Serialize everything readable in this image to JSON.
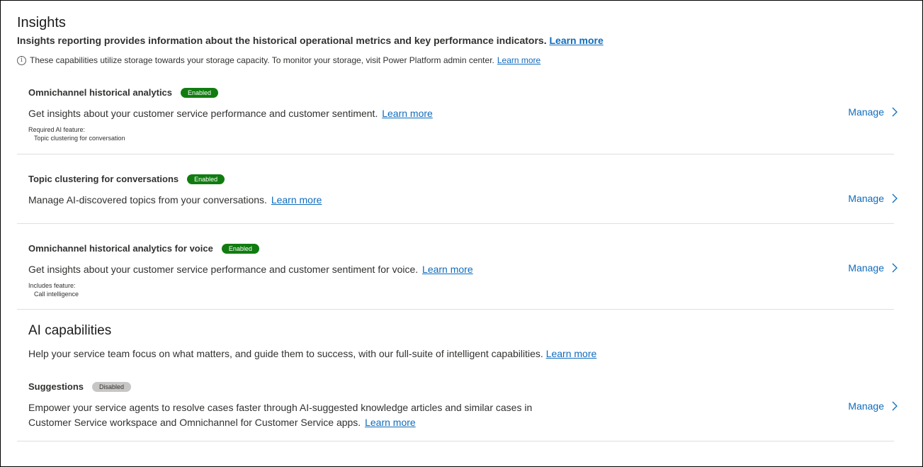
{
  "insights": {
    "title": "Insights",
    "description": "Insights reporting provides information about the historical operational metrics and key performance indicators.",
    "learn_more": "Learn more",
    "notice": "These capabilities utilize storage towards your storage capacity. To monitor your storage, visit Power Platform admin center.",
    "notice_learn_more": "Learn more"
  },
  "cards": [
    {
      "title": "Omnichannel historical analytics",
      "badge": "Enabled",
      "description": "Get insights about your customer service performance and customer sentiment.",
      "learn_more": "Learn more",
      "meta_label": "Required AI feature:",
      "meta_value": "Topic clustering for conversation",
      "manage": "Manage"
    },
    {
      "title": "Topic clustering for conversations",
      "badge": "Enabled",
      "description": "Manage AI-discovered topics from your conversations.",
      "learn_more": "Learn more",
      "manage": "Manage"
    },
    {
      "title": "Omnichannel historical analytics for voice",
      "badge": "Enabled",
      "description": "Get insights about your customer service performance and customer sentiment for voice.",
      "learn_more": "Learn more",
      "meta_label": "Includes feature:",
      "meta_value": "Call intelligence",
      "manage": "Manage"
    }
  ],
  "ai": {
    "title": "AI capabilities",
    "description": "Help your service team focus on what matters, and guide them to success, with our full-suite of intelligent capabilities.",
    "learn_more": "Learn more",
    "suggestions": {
      "title": "Suggestions",
      "badge": "Disabled",
      "description_line1": "Empower your service agents to resolve cases faster through AI-suggested knowledge articles and similar cases in",
      "description_line2": "Customer Service workspace and Omnichannel for Customer Service apps.",
      "learn_more": "Learn more",
      "manage": "Manage"
    }
  },
  "colors": {
    "link": "#0f6cbd",
    "enabled_badge": "#107c10",
    "disabled_badge": "#c8c6c4"
  },
  "icons": {
    "info": "info-circle-icon",
    "chevron": "chevron-right-icon"
  }
}
